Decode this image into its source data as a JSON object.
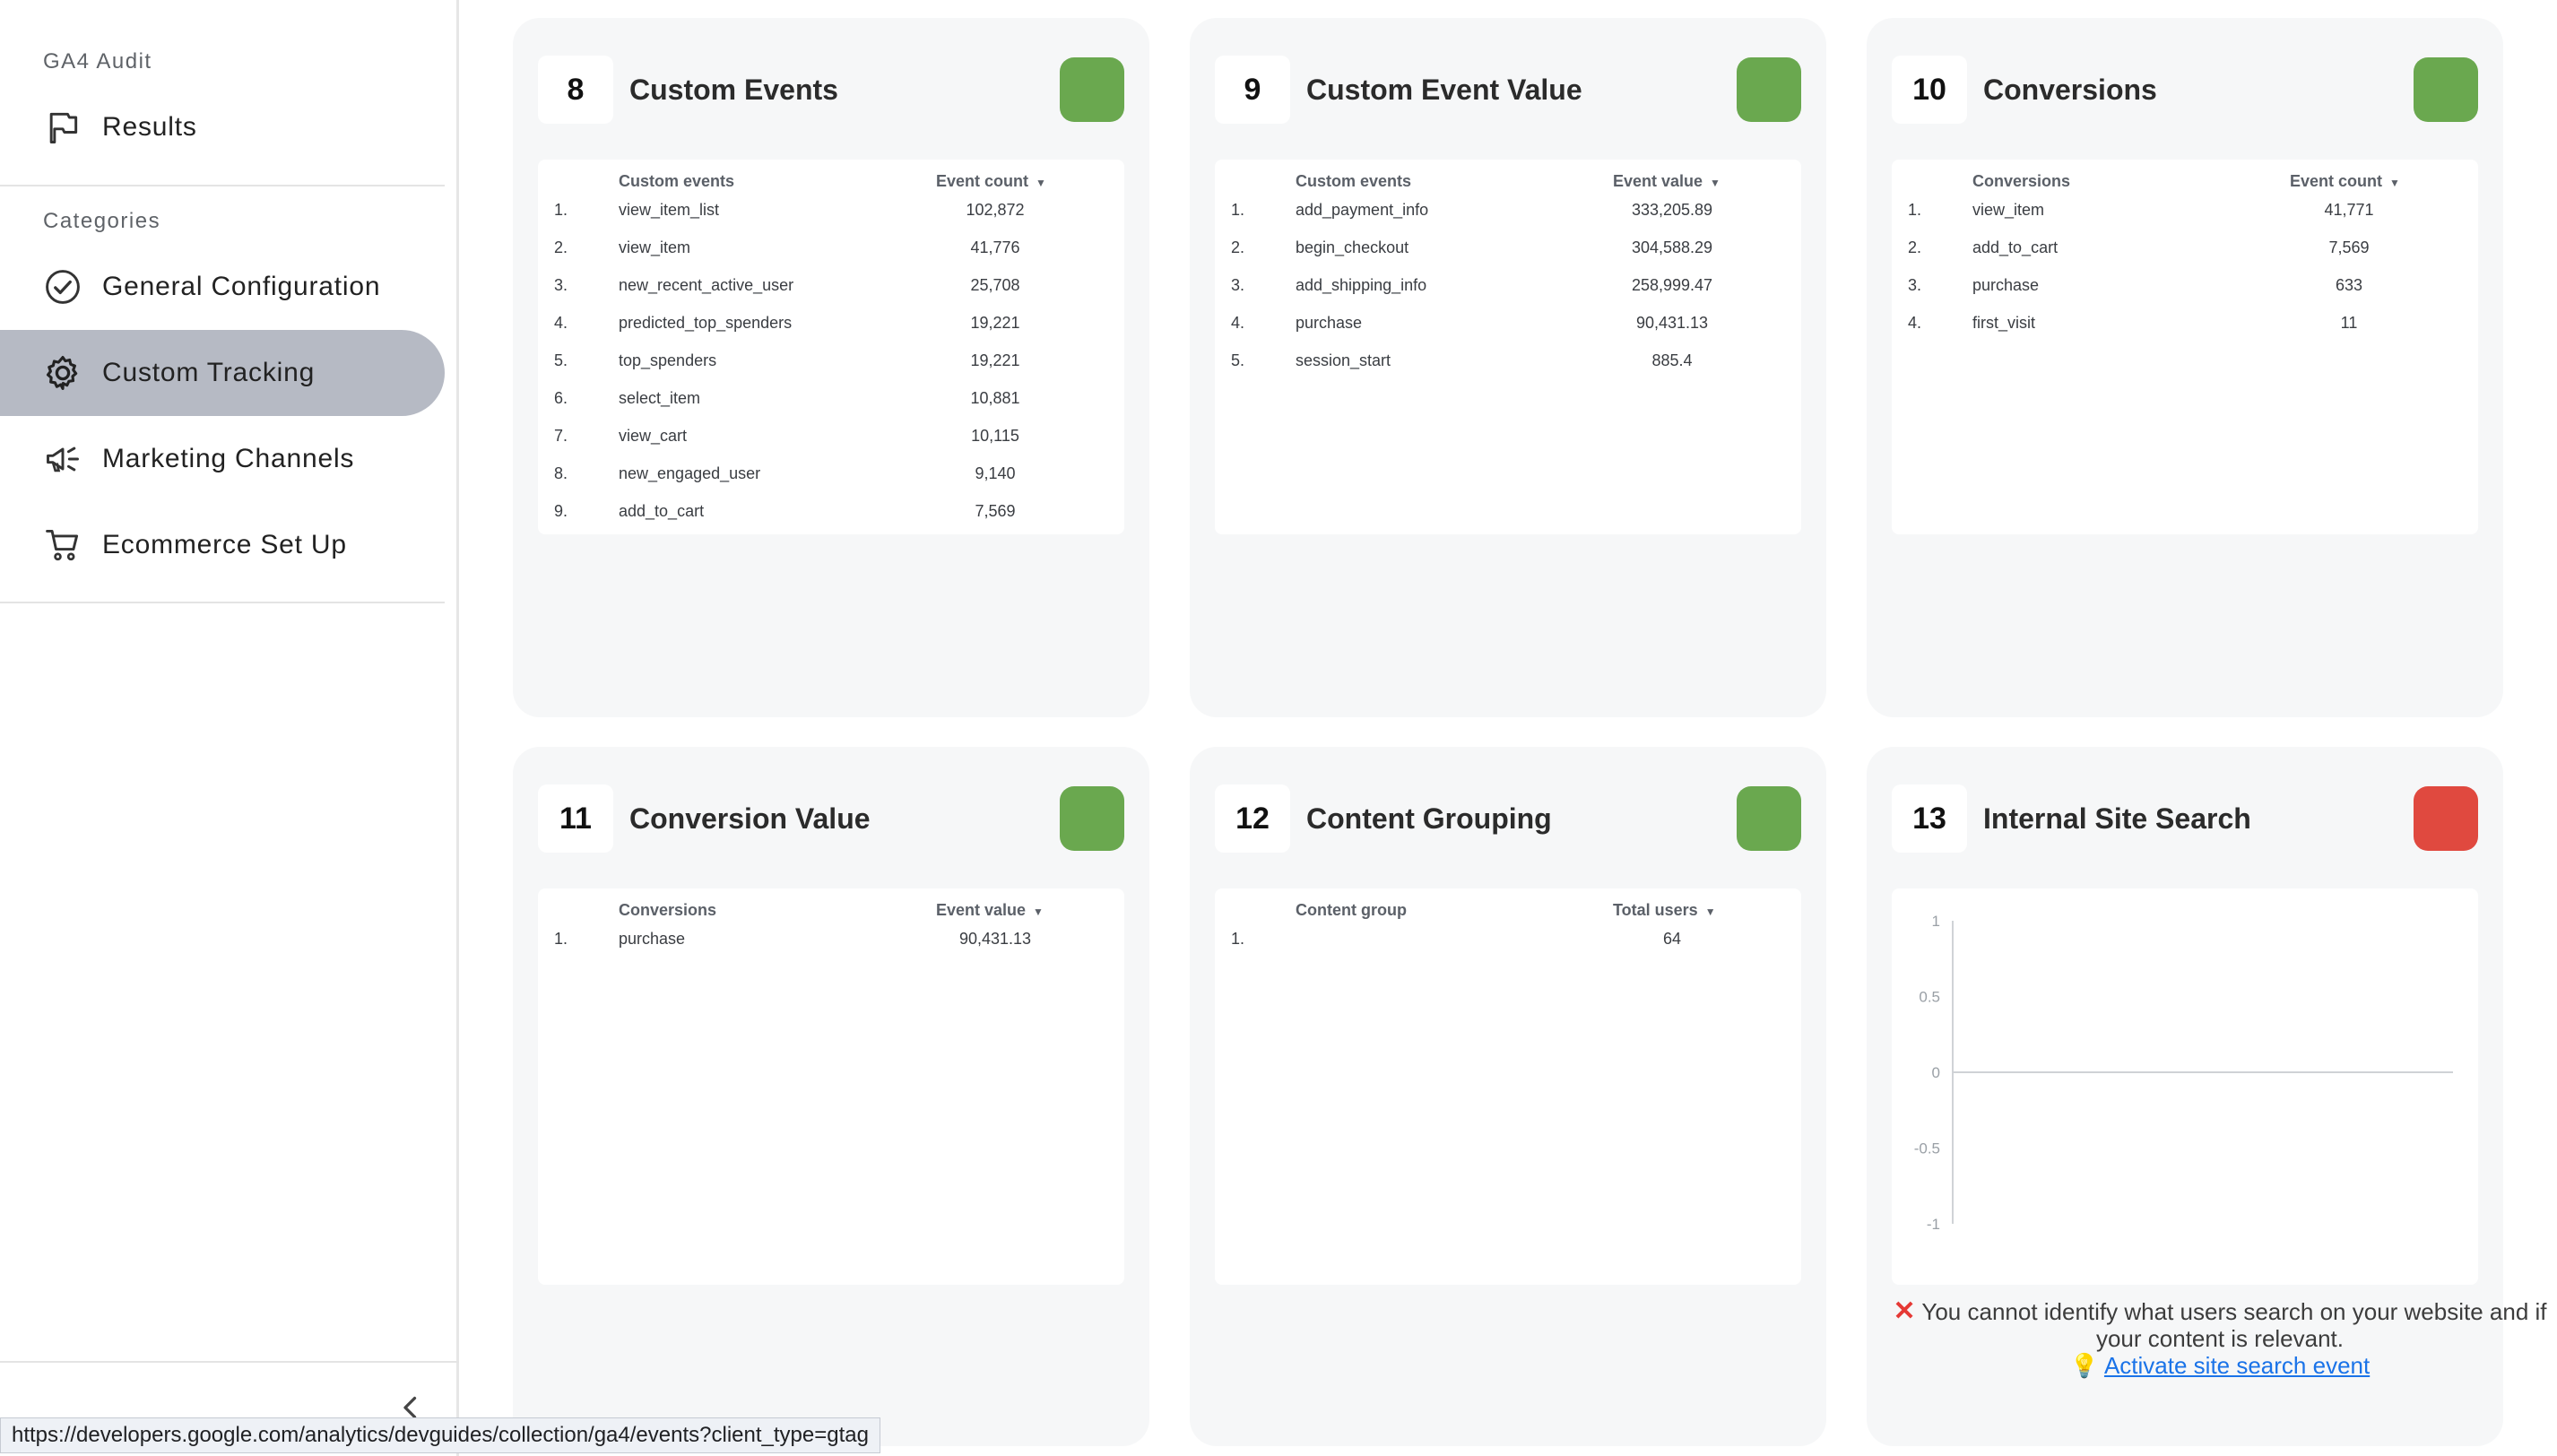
{
  "sidebar": {
    "app_title": "GA4 Audit",
    "results_label": "Results",
    "categories_heading": "Categories",
    "items": [
      {
        "label": "General Configuration",
        "icon": "check-circle-icon"
      },
      {
        "label": "Custom Tracking",
        "icon": "gear-icon",
        "active": true
      },
      {
        "label": "Marketing Channels",
        "icon": "megaphone-icon"
      },
      {
        "label": "Ecommerce Set Up",
        "icon": "cart-icon"
      }
    ]
  },
  "status_colors": {
    "pass": "#6aa84f",
    "fail": "#e0493f"
  },
  "cards": {
    "c8": {
      "number": "8",
      "title": "Custom Events",
      "status": "pass",
      "col1": "Custom events",
      "col2": "Event count",
      "rows": [
        {
          "i": "1.",
          "name": "view_item_list",
          "value": "102,872"
        },
        {
          "i": "2.",
          "name": "view_item",
          "value": "41,776"
        },
        {
          "i": "3.",
          "name": "new_recent_active_user",
          "value": "25,708"
        },
        {
          "i": "4.",
          "name": "predicted_top_spenders",
          "value": "19,221"
        },
        {
          "i": "5.",
          "name": "top_spenders",
          "value": "19,221"
        },
        {
          "i": "6.",
          "name": "select_item",
          "value": "10,881"
        },
        {
          "i": "7.",
          "name": "view_cart",
          "value": "10,115"
        },
        {
          "i": "8.",
          "name": "new_engaged_user",
          "value": "9,140"
        },
        {
          "i": "9.",
          "name": "add_to_cart",
          "value": "7,569"
        }
      ]
    },
    "c9": {
      "number": "9",
      "title": "Custom Event Value",
      "status": "pass",
      "col1": "Custom events",
      "col2": "Event value",
      "rows": [
        {
          "i": "1.",
          "name": "add_payment_info",
          "value": "333,205.89"
        },
        {
          "i": "2.",
          "name": "begin_checkout",
          "value": "304,588.29"
        },
        {
          "i": "3.",
          "name": "add_shipping_info",
          "value": "258,999.47"
        },
        {
          "i": "4.",
          "name": "purchase",
          "value": "90,431.13"
        },
        {
          "i": "5.",
          "name": "session_start",
          "value": "885.4"
        }
      ]
    },
    "c10": {
      "number": "10",
      "title": "Conversions",
      "status": "pass",
      "col1": "Conversions",
      "col2": "Event count",
      "rows": [
        {
          "i": "1.",
          "name": "view_item",
          "value": "41,771"
        },
        {
          "i": "2.",
          "name": "add_to_cart",
          "value": "7,569"
        },
        {
          "i": "3.",
          "name": "purchase",
          "value": "633"
        },
        {
          "i": "4.",
          "name": "first_visit",
          "value": "11"
        }
      ]
    },
    "c11": {
      "number": "11",
      "title": "Conversion Value",
      "status": "pass",
      "col1": "Conversions",
      "col2": "Event value",
      "rows": [
        {
          "i": "1.",
          "name": "purchase",
          "value": "90,431.13"
        }
      ]
    },
    "c12": {
      "number": "12",
      "title": "Content Grouping",
      "status": "pass",
      "col1": "Content group",
      "col2": "Total users",
      "rows": [
        {
          "i": "1.",
          "name": "",
          "value": "64"
        }
      ]
    },
    "c13": {
      "number": "13",
      "title": "Internal Site Search",
      "status": "fail",
      "message": "You cannot identify what users search on your website and if your content is relevant.",
      "link_label": "Activate site search event"
    }
  },
  "chart_data": {
    "type": "line",
    "series": [],
    "y_ticks": [
      "1",
      "0.5",
      "0",
      "-0.5",
      "-1"
    ],
    "ylim": [
      -1,
      1
    ]
  },
  "status_bar": {
    "url": "https://developers.google.com/analytics/devguides/collection/ga4/events?client_type=gtag"
  }
}
